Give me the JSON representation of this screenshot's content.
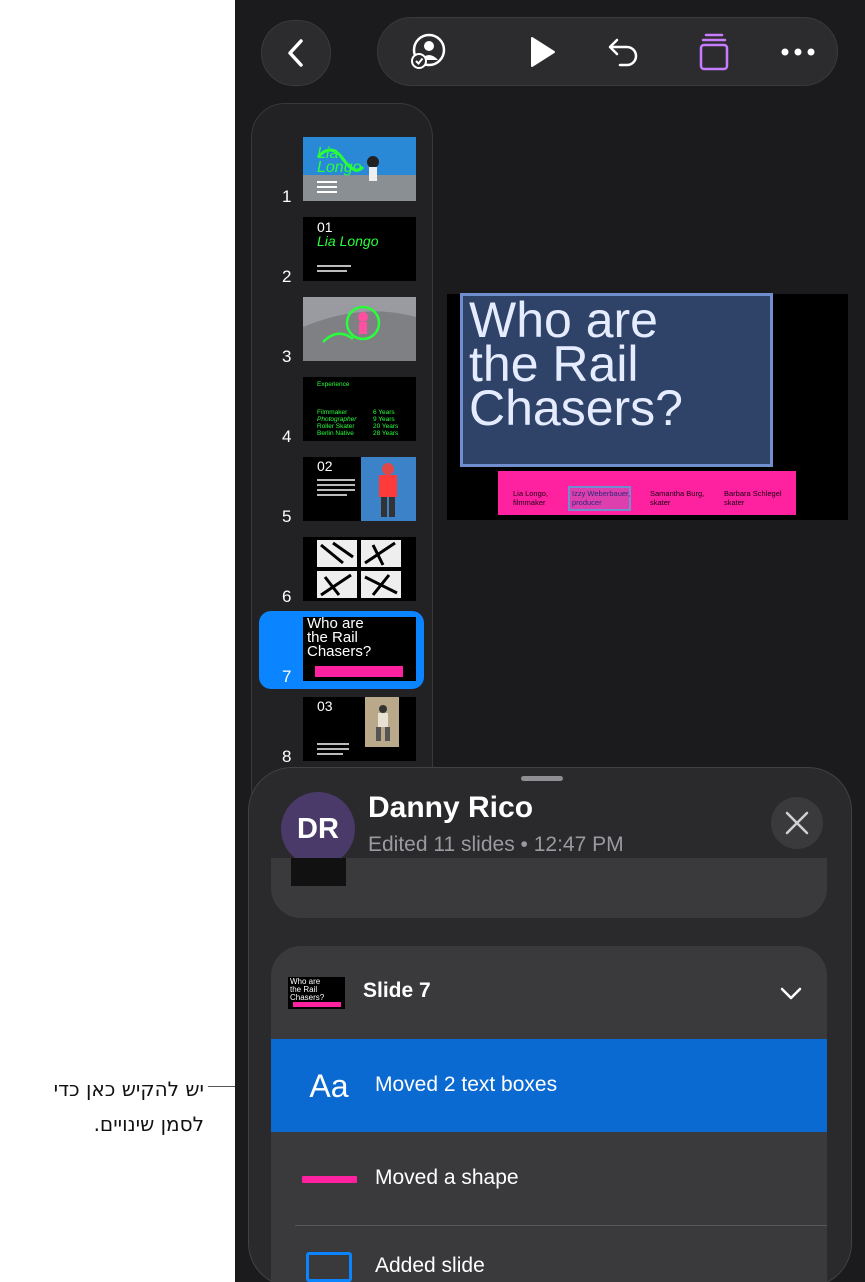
{
  "callout": {
    "text": "יש להקיש כאן כדי לסמן שינויים."
  },
  "toolbar": {
    "back_icon": "chevron-left-icon",
    "collaborate_icon": "person-checkmark-icon",
    "play_icon": "play-icon",
    "undo_icon": "undo-icon",
    "slides_icon": "stacked-slides-icon",
    "more_icon": "ellipsis-icon",
    "slides_icon_color": "#c77dff"
  },
  "navigator": {
    "slides": [
      {
        "number": "1",
        "thumb_text": "Lia\nLongo"
      },
      {
        "number": "2",
        "thumb_text_a": "01",
        "thumb_text_b": "Lia Longo"
      },
      {
        "number": "3"
      },
      {
        "number": "4",
        "heading": "Experience",
        "rows": [
          {
            "label": "Filmmaker",
            "value": "6 Years"
          },
          {
            "label": "Photographer",
            "value": "9 Years"
          },
          {
            "label": "Roller Skater",
            "value": "20 Years"
          },
          {
            "label": "Berlin Native",
            "value": "28 Years"
          }
        ]
      },
      {
        "number": "5",
        "thumb_text": "02"
      },
      {
        "number": "6"
      },
      {
        "number": "7",
        "thumb_text": "Who are\nthe Rail\nChasers?",
        "selected": true
      },
      {
        "number": "8",
        "thumb_text": "03"
      }
    ]
  },
  "slide": {
    "title": "Who are\nthe Rail\nChasers?",
    "credits": [
      {
        "name": "Lia Longo,\nfilmmaker"
      },
      {
        "name": "Izzy Weberbauer,\nproducer"
      },
      {
        "name": "Samantha Burg,\nskater"
      },
      {
        "name": "Barbara Schlegel\nskater"
      }
    ],
    "accent_color": "#ff22a0"
  },
  "sheet": {
    "avatar_initials": "DR",
    "author_name": "Danny Rico",
    "author_sub": "Edited 11 slides • 12:47 PM",
    "close_icon": "close-icon",
    "group": {
      "thumb_text": "Who are\nthe Rail\nChasers?",
      "title": "Slide 7",
      "chevron_icon": "chevron-down-icon",
      "changes": [
        {
          "icon": "text-aa-icon",
          "icon_text": "Aa",
          "label": "Moved 2 text boxes",
          "highlighted": true
        },
        {
          "icon": "shape-icon",
          "label": "Moved a shape",
          "highlighted": false
        },
        {
          "icon": "slide-icon",
          "label": "Added slide",
          "highlighted": false
        }
      ]
    }
  }
}
